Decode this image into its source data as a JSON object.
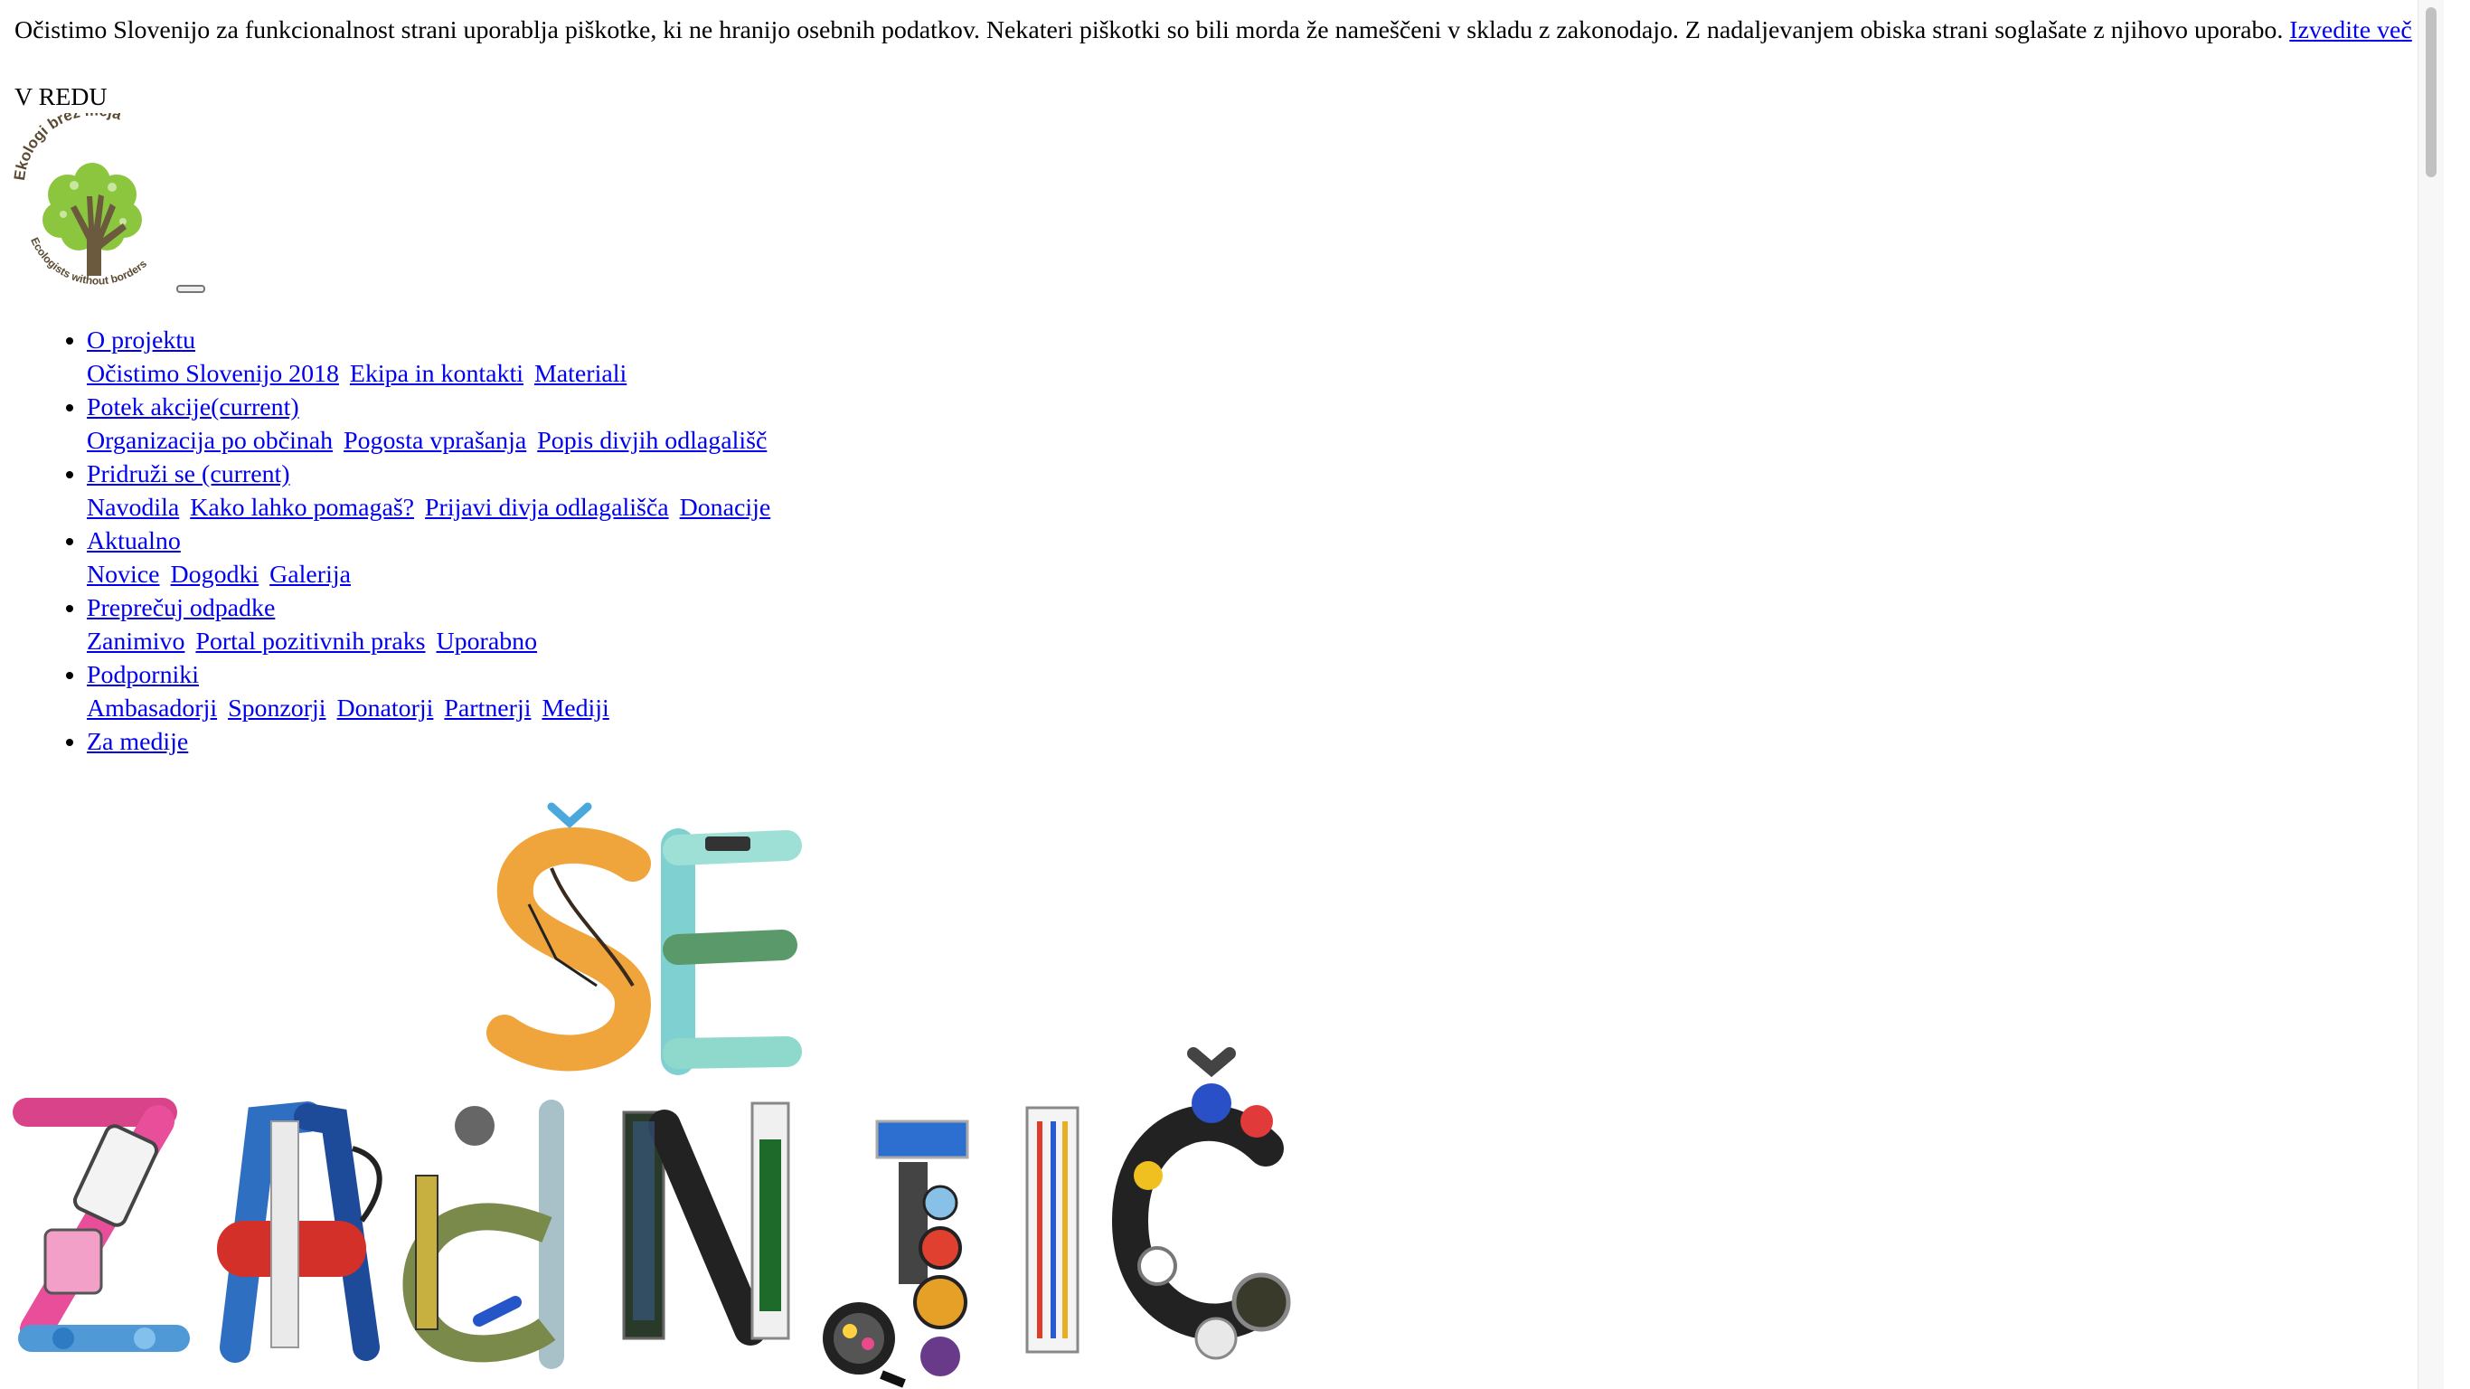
{
  "cookie": {
    "text": "Očistimo Slovenijo za funkcionalnost strani uporablja piškotke, ki ne hranijo osebnih podatkov. Nekateri piškotki so bili morda že nameščeni v skladu z zakonodajo. Z nadaljevanjem obiska strani soglašate z njihovo uporabo.",
    "link": "Izvedite več",
    "ok": "V REDU"
  },
  "logo": {
    "top_text": "Ekologi brez meja",
    "bottom_text": "Ecologists without borders"
  },
  "menu": [
    {
      "label": "O projektu",
      "sub": [
        "Očistimo Slovenijo 2018",
        "Ekipa in kontakti",
        "Materiali"
      ]
    },
    {
      "label": "Potek akcije(current)",
      "sub": [
        "Organizacija po občinah",
        "Pogosta vprašanja",
        "Popis divjih odlagališč"
      ]
    },
    {
      "label": "Pridruži se (current)",
      "sub": [
        "Navodila",
        "Kako lahko pomagaš?",
        "Prijavi divja odlagališča",
        "Donacije"
      ]
    },
    {
      "label": "Aktualno",
      "sub": [
        "Novice",
        "Dogodki",
        "Galerija"
      ]
    },
    {
      "label": "Preprečuj odpadke",
      "sub": [
        "Zanimivo",
        "Portal pozitivnih praks",
        "Uporabno"
      ]
    },
    {
      "label": "Podporniki",
      "sub": [
        "Ambasadorji",
        "Sponzorji",
        "Donatorji",
        "Partnerji",
        "Mediji"
      ]
    },
    {
      "label": "Za medije",
      "sub": []
    }
  ],
  "hero": {
    "line1": "ŠE",
    "line2": "ZADNJIČ"
  },
  "colors": {
    "link": "#0000ee",
    "logo_green": "#8cc63f",
    "trunk": "#6b5a3e",
    "chevron": "#4aa8dc"
  }
}
